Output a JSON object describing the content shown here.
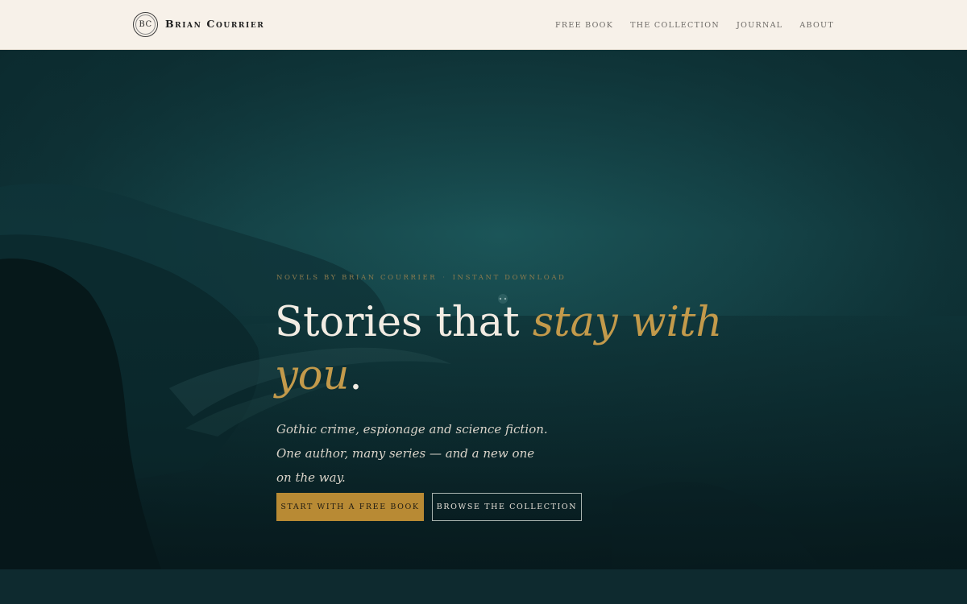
{
  "header": {
    "logo_initials": "BC",
    "brand_name": "Brian Courrier",
    "nav": [
      {
        "label": "FREE BOOK"
      },
      {
        "label": "THE COLLECTION"
      },
      {
        "label": "JOURNAL"
      },
      {
        "label": "ABOUT"
      }
    ]
  },
  "hero": {
    "eyebrow_left": "NOVELS BY BRIAN COURRIER",
    "eyebrow_separator": "·",
    "eyebrow_right": "INSTANT DOWNLOAD",
    "headline_plain": "Stories that ",
    "headline_accent": "stay with you",
    "headline_end": ".",
    "subhead": "Gothic crime, espionage and science fiction. One author, many series — and a new one on the way.",
    "primary_cta": "START WITH A FREE BOOK",
    "secondary_cta": "BROWSE THE COLLECTION"
  },
  "colors": {
    "header_bg": "#f7f1e9",
    "hero_teal": "#154448",
    "accent_gold": "#c39a4b",
    "button_gold": "#b88a34"
  }
}
